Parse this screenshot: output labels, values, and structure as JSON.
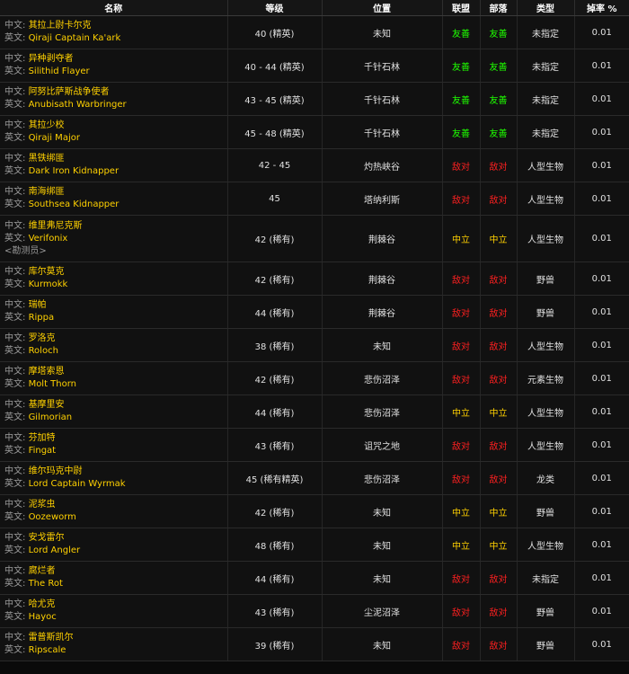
{
  "headers": {
    "name": "名称",
    "level": "等级",
    "location": "位置",
    "alliance": "联盟",
    "horde": "部落",
    "type": "类型",
    "droprate": "掉率 %"
  },
  "labels": {
    "cn": "中文:",
    "en": "英文:"
  },
  "reaction_colors": {
    "friendly": "#1eff00",
    "hostile": "#ff2020",
    "neutral": "#ffd100"
  },
  "rows": [
    {
      "cn": "其拉上尉卡尔克",
      "en": "Qiraji Captain Ka'ark",
      "level": "40 (精英)",
      "location": "未知",
      "alliance": "友善",
      "horde": "友善",
      "reaction": "friendly",
      "type": "未指定",
      "droprate": "0.01"
    },
    {
      "cn": "异种剥夺者",
      "en": "Silithid Flayer",
      "level": "40 - 44 (精英)",
      "location": "千针石林",
      "alliance": "友善",
      "horde": "友善",
      "reaction": "friendly",
      "type": "未指定",
      "droprate": "0.01"
    },
    {
      "cn": "阿努比萨斯战争使者",
      "en": "Anubisath Warbringer",
      "level": "43 - 45 (精英)",
      "location": "千针石林",
      "alliance": "友善",
      "horde": "友善",
      "reaction": "friendly",
      "type": "未指定",
      "droprate": "0.01"
    },
    {
      "cn": "其拉少校",
      "en": "Qiraji Major",
      "level": "45 - 48 (精英)",
      "location": "千针石林",
      "alliance": "友善",
      "horde": "友善",
      "reaction": "friendly",
      "type": "未指定",
      "droprate": "0.01"
    },
    {
      "cn": "黑铁绑匪",
      "en": "Dark Iron Kidnapper",
      "level": "42 - 45",
      "location": "灼热峡谷",
      "alliance": "敌对",
      "horde": "敌对",
      "reaction": "hostile",
      "type": "人型生物",
      "droprate": "0.01"
    },
    {
      "cn": "南海绑匪",
      "en": "Southsea Kidnapper",
      "level": "45",
      "location": "塔纳利斯",
      "alliance": "敌对",
      "horde": "敌对",
      "reaction": "hostile",
      "type": "人型生物",
      "droprate": "0.01"
    },
    {
      "cn": "维里弗尼克斯",
      "en": "Verifonix",
      "subtitle": "<勘测员>",
      "level": "42 (稀有)",
      "location": "荆棘谷",
      "alliance": "中立",
      "horde": "中立",
      "reaction": "neutral",
      "type": "人型生物",
      "droprate": "0.01"
    },
    {
      "cn": "库尔莫克",
      "en": "Kurmokk",
      "level": "42 (稀有)",
      "location": "荆棘谷",
      "alliance": "敌对",
      "horde": "敌对",
      "reaction": "hostile",
      "type": "野兽",
      "droprate": "0.01"
    },
    {
      "cn": "瑞帕",
      "en": "Rippa",
      "level": "44 (稀有)",
      "location": "荆棘谷",
      "alliance": "敌对",
      "horde": "敌对",
      "reaction": "hostile",
      "type": "野兽",
      "droprate": "0.01"
    },
    {
      "cn": "罗洛克",
      "en": "Roloch",
      "level": "38 (稀有)",
      "location": "未知",
      "alliance": "敌对",
      "horde": "敌对",
      "reaction": "hostile",
      "type": "人型生物",
      "droprate": "0.01"
    },
    {
      "cn": "摩塔索恩",
      "en": "Molt Thorn",
      "level": "42 (稀有)",
      "location": "悲伤沼泽",
      "alliance": "敌对",
      "horde": "敌对",
      "reaction": "hostile",
      "type": "元素生物",
      "droprate": "0.01"
    },
    {
      "cn": "基摩里安",
      "en": "Gilmorian",
      "level": "44 (稀有)",
      "location": "悲伤沼泽",
      "alliance": "中立",
      "horde": "中立",
      "reaction": "neutral",
      "type": "人型生物",
      "droprate": "0.01"
    },
    {
      "cn": "芬加特",
      "en": "Fingat",
      "level": "43 (稀有)",
      "location": "诅咒之地",
      "alliance": "敌对",
      "horde": "敌对",
      "reaction": "hostile",
      "type": "人型生物",
      "droprate": "0.01"
    },
    {
      "cn": "维尔玛克中尉",
      "en": "Lord Captain Wyrmak",
      "level": "45 (稀有精英)",
      "location": "悲伤沼泽",
      "alliance": "敌对",
      "horde": "敌对",
      "reaction": "hostile",
      "type": "龙类",
      "droprate": "0.01"
    },
    {
      "cn": "泥浆虫",
      "en": "Oozeworm",
      "level": "42 (稀有)",
      "location": "未知",
      "alliance": "中立",
      "horde": "中立",
      "reaction": "neutral",
      "type": "野兽",
      "droprate": "0.01"
    },
    {
      "cn": "安戈雷尔",
      "en": "Lord Angler",
      "level": "48 (稀有)",
      "location": "未知",
      "alliance": "中立",
      "horde": "中立",
      "reaction": "neutral",
      "type": "人型生物",
      "droprate": "0.01"
    },
    {
      "cn": "腐烂者",
      "en": "The Rot",
      "level": "44 (稀有)",
      "location": "未知",
      "alliance": "敌对",
      "horde": "敌对",
      "reaction": "hostile",
      "type": "未指定",
      "droprate": "0.01"
    },
    {
      "cn": "哈尤克",
      "en": "Hayoc",
      "level": "43 (稀有)",
      "location": "尘泥沼泽",
      "alliance": "敌对",
      "horde": "敌对",
      "reaction": "hostile",
      "type": "野兽",
      "droprate": "0.01"
    },
    {
      "cn": "雷普斯凯尔",
      "en": "Ripscale",
      "level": "39 (稀有)",
      "location": "未知",
      "alliance": "敌对",
      "horde": "敌对",
      "reaction": "hostile",
      "type": "野兽",
      "droprate": "0.01"
    }
  ]
}
